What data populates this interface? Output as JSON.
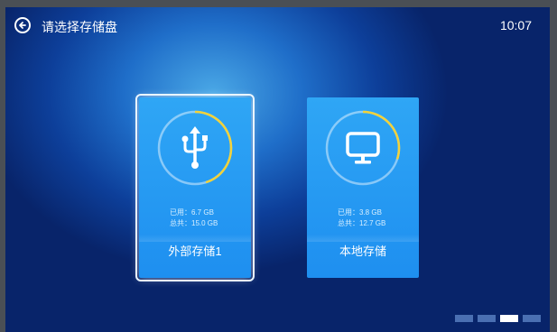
{
  "header": {
    "title": "请选择存储盘",
    "time": "10:07"
  },
  "cards": [
    {
      "used": "已用：6.7 GB",
      "total": "总共：15.0 GB",
      "name": "外部存储1",
      "usage_fraction": 0.45,
      "icon": "usb-icon",
      "selected": true
    },
    {
      "used": "已用：3.8 GB",
      "total": "总共：12.7 GB",
      "name": "本地存储",
      "usage_fraction": 0.3,
      "icon": "monitor-icon",
      "selected": false
    }
  ],
  "pager": {
    "count": 4,
    "active_index": 2
  },
  "colors": {
    "accent_ring": "#f2d23a",
    "card": "#2fa6f5"
  }
}
